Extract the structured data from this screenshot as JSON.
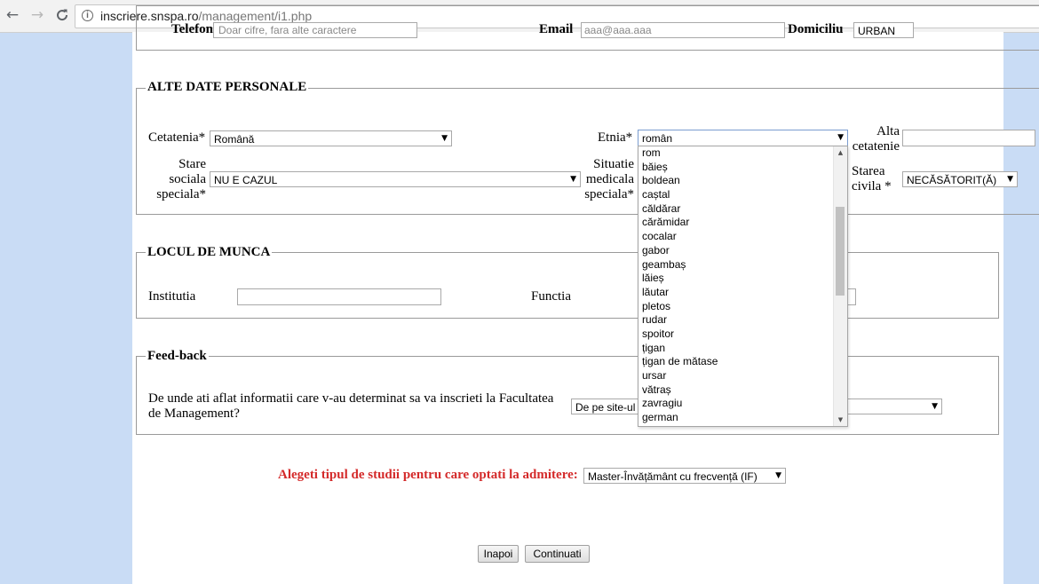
{
  "browser": {
    "back_icon": "←",
    "forward_icon": "→",
    "reload_icon": "C",
    "url_host": "inscriere.snspa.ro",
    "url_path": "/management/i1.php"
  },
  "top_row": {
    "left_field_placeholder": "Doar cifre, fara alte caractere",
    "email_label": "Email",
    "email_value": "aaa@aaa.aaa",
    "domiciliu_label": "Domiciliu",
    "domiciliu_value": "URBAN"
  },
  "personal": {
    "legend": "ALTE DATE PERSONALE",
    "cetatenia_label": "Cetatenia*",
    "cetatenia_value": "Română",
    "etnia_label": "Etnia*",
    "etnia_value": "român",
    "alta_cetatenie_label_1": "Alta",
    "alta_cetatenie_label_2": "cetatenie",
    "stare_sociala_label_1": "Stare",
    "stare_sociala_label_2": "sociala",
    "stare_sociala_label_3": "speciala*",
    "stare_sociala_value": "NU E CAZUL",
    "situatie_medicala_label_1": "Situatie",
    "situatie_medicala_label_2": "medicala",
    "situatie_medicala_label_3": "speciala*",
    "starea_civila_label_1": "Starea",
    "starea_civila_label_2": "civila *",
    "starea_civila_value": "NECĂSĂTORIT(Ă)"
  },
  "etnia_dropdown": {
    "options": [
      "rom",
      "băieș",
      "boldean",
      "caștal",
      "căldărar",
      "cărămidar",
      "cocalar",
      "gabor",
      "geambaș",
      "lăieș",
      "lăutar",
      "pletos",
      "rudar",
      "spoitor",
      "țigan",
      "țigan de mătase",
      "ursar",
      "vătraș",
      "zavragiu",
      "german"
    ]
  },
  "work": {
    "legend": "LOCUL DE MUNCA",
    "institutia_label": "Institutia",
    "functia_label": "Functia"
  },
  "feedback": {
    "legend": "Feed-back",
    "question_line_1": "De unde ati aflat informatii care v-au determinat sa va inscrieti la Facultatea",
    "question_line_2": "de Management?",
    "answer_value": "De pe site-ul"
  },
  "study": {
    "label": "Alegeti tipul de studii pentru care optati la admitere:",
    "value": "Master-Învățământ cu frecvență (IF)"
  },
  "buttons": {
    "back_label": "Inapoi",
    "continue_label": "Continuati"
  },
  "colors": {
    "page_background": "#c9dcf5",
    "red_label": "#d42a2a"
  }
}
